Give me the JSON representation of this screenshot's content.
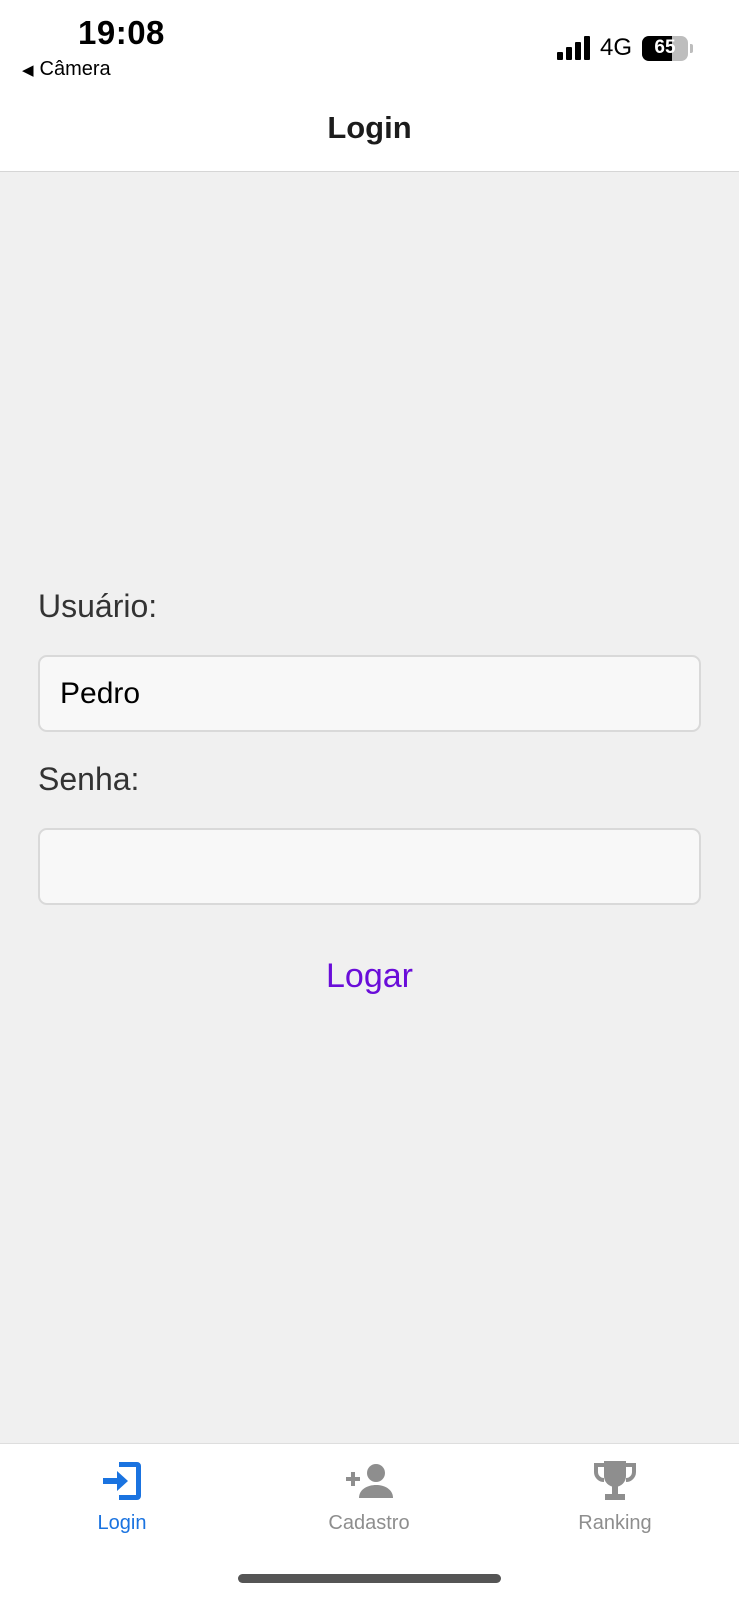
{
  "status_bar": {
    "time": "19:08",
    "back_label": "Câmera",
    "network": "4G",
    "battery": "65"
  },
  "header": {
    "title": "Login"
  },
  "form": {
    "username_label": "Usuário:",
    "username_value": "Pedro",
    "password_label": "Senha:",
    "password_value": "",
    "submit_label": "Logar"
  },
  "tabs": [
    {
      "label": "Login",
      "icon": "login-icon",
      "active": true
    },
    {
      "label": "Cadastro",
      "icon": "add-user-icon",
      "active": false
    },
    {
      "label": "Ranking",
      "icon": "trophy-icon",
      "active": false
    }
  ],
  "colors": {
    "accent_tab": "#1a73e0",
    "inactive_tab": "#8e8e8e",
    "submit_text": "#6a0dd9",
    "background": "#f0f0f0"
  }
}
